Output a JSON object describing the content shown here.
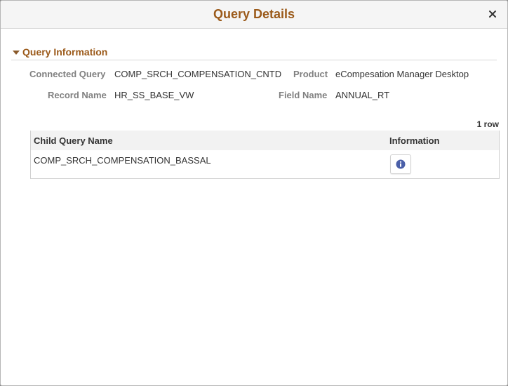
{
  "dialog": {
    "title": "Query Details",
    "close_glyph": "×"
  },
  "section": {
    "title": "Query Information",
    "icon": "caret-down-icon"
  },
  "fields": {
    "connected_query_label": "Connected Query",
    "connected_query_value": "COMP_SRCH_COMPENSATION_CNTD",
    "product_label": "Product",
    "product_value": "eCompesation Manager Desktop",
    "record_name_label": "Record Name",
    "record_name_value": "HR_SS_BASE_VW",
    "field_name_label": "Field Name",
    "field_name_value": "ANNUAL_RT"
  },
  "grid": {
    "row_count": "1 row",
    "columns": [
      "Child Query Name",
      "Information"
    ],
    "rows": [
      {
        "child_query_name": "COMP_SRCH_COMPENSATION_BASSAL",
        "info_icon": "info-icon"
      }
    ]
  },
  "colors": {
    "title": "#9b5a1a",
    "label": "#808080",
    "info_icon": "#4a5fa8"
  }
}
